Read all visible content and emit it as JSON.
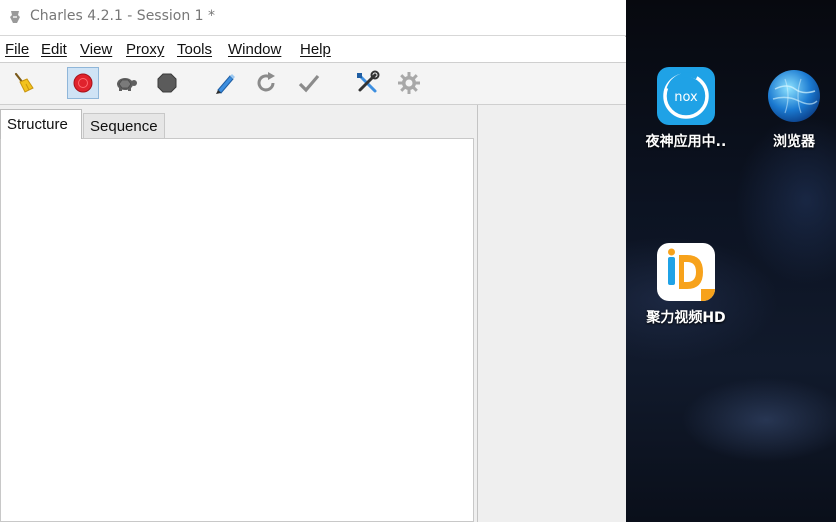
{
  "window": {
    "title": "Charles 4.2.1 - Session 1 *"
  },
  "menu": [
    {
      "label": "File"
    },
    {
      "label": "Edit"
    },
    {
      "label": "View"
    },
    {
      "label": "Proxy"
    },
    {
      "label": "Tools"
    },
    {
      "label": "Window"
    },
    {
      "label": "Help"
    }
  ],
  "toolbar": [
    {
      "icon": "broom-icon",
      "name": "clear-session-button"
    },
    {
      "icon": "record-icon",
      "name": "record-button",
      "active": true
    },
    {
      "icon": "turtle-icon",
      "name": "throttle-button"
    },
    {
      "icon": "stop-hexagon-icon",
      "name": "breakpoints-button"
    },
    {
      "icon": "pen-icon",
      "name": "compose-button"
    },
    {
      "icon": "refresh-icon",
      "name": "repeat-button"
    },
    {
      "icon": "check-icon",
      "name": "validate-button"
    },
    {
      "icon": "tools-icon",
      "name": "tools-button"
    },
    {
      "icon": "gear-icon",
      "name": "settings-button"
    }
  ],
  "tabs": [
    {
      "label": "Structure",
      "active": true
    },
    {
      "label": "Sequence",
      "active": false
    }
  ],
  "desktop": {
    "apps": [
      {
        "label": "夜神应用中..",
        "icon": "nox-app-center-icon",
        "icon_text": "nox"
      },
      {
        "label": "浏览器",
        "icon": "browser-globe-icon"
      },
      {
        "label": "聚力视频HD",
        "icon": "pptv-video-icon"
      }
    ]
  },
  "colors": {
    "record_red": "#e0222c",
    "active_tool_bg": "#cfe3f5",
    "nox_blue": "#1fa2e6",
    "pptv_orange": "#f7a21b"
  }
}
